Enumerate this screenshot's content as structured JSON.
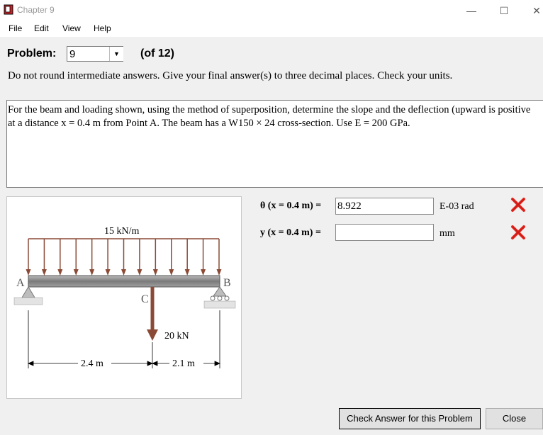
{
  "window": {
    "title": "Chapter 9",
    "minimize_glyph": "—",
    "maximize_glyph": "☐",
    "close_glyph": "✕"
  },
  "menu": [
    "File",
    "Edit",
    "View",
    "Help"
  ],
  "problem": {
    "label": "Problem:",
    "selected": "9",
    "of_text": "(of 12)",
    "instructions": "Do not round intermediate answers.  Give your final answer(s) to three decimal places.  Check your units.",
    "text_line1": "For the beam and loading shown, using the method of superposition, determine the slope and the deflection (upward is positive",
    "text_line2": "at a distance x = 0.4 m from Point A.  The beam has a W150 × 24 cross-section.  Use E = 200 GPa."
  },
  "figure": {
    "load_label": "15 kN/m",
    "point_a": "A",
    "point_b": "B",
    "point_c": "C",
    "force_label": "20 kN",
    "dim_left": "2.4 m",
    "dim_right": "2.1 m"
  },
  "answers": [
    {
      "label": "θ (x = 0.4 m) =",
      "value": "8.922",
      "unit": "E-03 rad",
      "status": "incorrect"
    },
    {
      "label": "y (x = 0.4 m) =",
      "value": "",
      "unit": "mm",
      "status": "incorrect"
    }
  ],
  "buttons": {
    "check": "Check Answer for this Problem",
    "close": "Close"
  },
  "colors": {
    "load_arrow": "#8b4a36",
    "beam": "#8a8a8a",
    "error_mark": "#e8261e"
  },
  "icons": {
    "app": "red-book-icon",
    "incorrect": "red-x-icon"
  }
}
